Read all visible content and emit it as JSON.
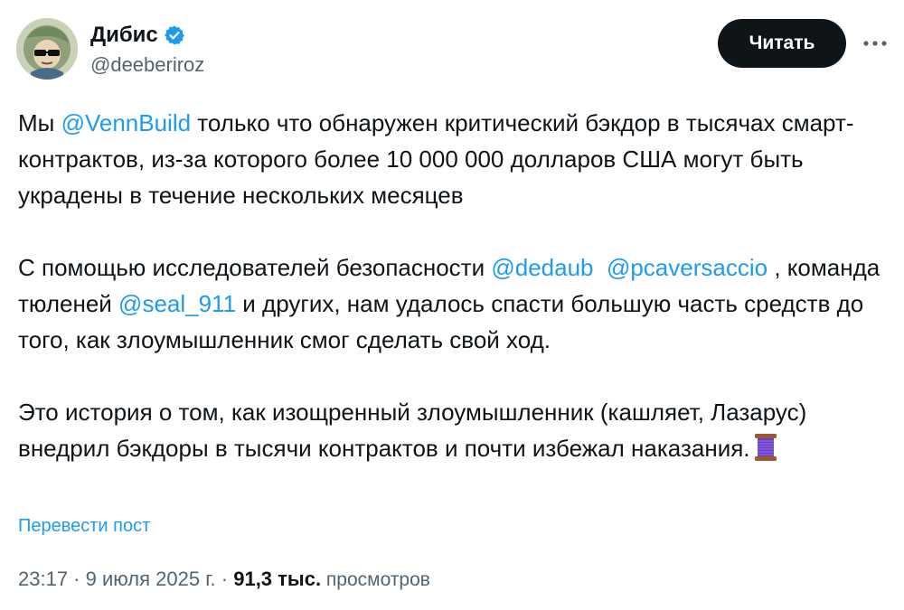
{
  "author": {
    "display_name": "Дибис",
    "handle": "@deeberiroz",
    "verified_color": "#1d9bf0"
  },
  "actions": {
    "follow_label": "Читать",
    "more_icon": "more-horizontal-icon"
  },
  "post": {
    "p1_before": "Мы ",
    "p1_mention": "@VennBuild",
    "p1_after": " только что обнаружен критический бэкдор в тысячах смарт-контрактов, из-за которого более 10 000 000 долларов США могут быть украдены в течение нескольких месяцев",
    "p2_before": "С помощью исследователей безопасности ",
    "p2_mention1": "@dedaub",
    "p2_mid1": "  ",
    "p2_mention2": "@pcaversaccio",
    "p2_mid2": " , команда тюленей ",
    "p2_mention3": "@seal_911",
    "p2_after": " и других, нам удалось спасти большую часть средств до того, как злоумышленник смог сделать свой ход.",
    "p3_text": "Это история о том, как изощренный злоумышленник (кашляет, Лазарус) внедрил бэкдоры в тысячи контрактов и почти избежал наказания.",
    "p3_emoji": "thread-spool-icon"
  },
  "translate_label": "Перевести пост",
  "meta": {
    "time": "23:17",
    "sep1": " · ",
    "date": "9 июля 2025 г.",
    "sep2": " · ",
    "views_count": "91,3 тыс.",
    "views_label": " просмотров"
  },
  "colors": {
    "link": "#1d9bf0",
    "text": "#0f1419",
    "muted": "#536471",
    "button_bg": "#0f1419"
  }
}
